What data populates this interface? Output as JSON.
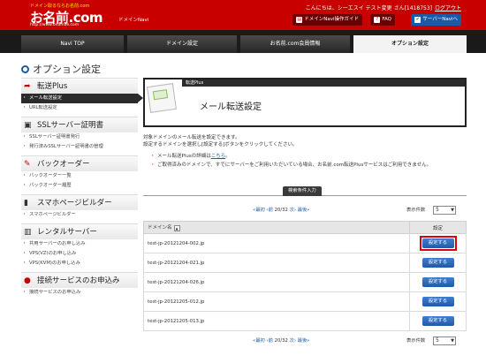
{
  "header": {
    "logo_tagline": "ドメイン取るならお名前.com",
    "logo_main": "お名前.com",
    "logo_url": "http://www.onamae.com",
    "logo_sub": "ドメインNavi",
    "greeting": "こんにちは、シーエスイ テスト変更 さん[1418753]",
    "logout": "ログアウト",
    "buttons": {
      "navi_guide": "ドメインNavi操作ガイド",
      "faq": "FAQ",
      "support": "サーバーNaviへ"
    }
  },
  "nav": {
    "tabs": [
      "Navi TOP",
      "ドメイン設定",
      "お名前.com会員情報",
      "オプション設定"
    ],
    "active_index": 3
  },
  "page_title": "オプション設定",
  "sidebar": {
    "sections": [
      {
        "title": "転送Plus",
        "icon": "arrow-icon",
        "items": [
          "メール転送設定",
          "URL転送設定"
        ]
      },
      {
        "title": "SSLサーバー証明書",
        "icon": "ssl-icon",
        "items": [
          "SSLサーバー証明書発行",
          "発行済みSSLサーバー証明書の管理"
        ]
      },
      {
        "title": "バックオーダー",
        "icon": "backorder-icon",
        "items": [
          "バックオーダー一覧",
          "バックオーダー履歴"
        ]
      },
      {
        "title": "スマホページビルダー",
        "icon": "smartphone-icon",
        "items": [
          "スマホページビルダー"
        ]
      },
      {
        "title": "レンタルサーバー",
        "icon": "server-icon",
        "items": [
          "共用サーバーのお申し込み",
          "VPS(VZ)のお申し込み",
          "VPS(KVM)のお申し込み"
        ]
      },
      {
        "title": "接続サービスのお申込み",
        "icon": "connect-icon",
        "items": [
          "接続サービスのお申込み"
        ]
      }
    ],
    "active_item": "メール転送設定"
  },
  "banner": {
    "strip": "転送Plus",
    "title": "メール転送設定"
  },
  "description": {
    "line1": "対象ドメインのメール転送を設定できます。",
    "line2": "設定するドメインを選択し[設定する]ボタンをクリックしてください。"
  },
  "notes": {
    "note1_prefix": "メール転送Plusの詳細は",
    "note1_link": "こちら",
    "note1_suffix": "。",
    "note2": "ご取得済みのドメインで、すでにサーバーをご利用いただいている場合、お名前.com転送Plusサービスはご利用できません。"
  },
  "search_tab": "検索条件入力",
  "pager": {
    "first": "«最初",
    "prev": "‹前",
    "current": "20/32",
    "next": "次›",
    "last": "最後»",
    "per_page_label": "表示件数",
    "per_page_value": "5"
  },
  "table": {
    "headers": {
      "domain": "ドメイン名",
      "setting": "設定"
    },
    "button_label": "設定する",
    "rows": [
      {
        "domain": "test-jp-20121204-002.jp",
        "highlight": true
      },
      {
        "domain": "test-jp-20121204-021.jp",
        "highlight": false
      },
      {
        "domain": "test-jp-20121204-026.jp",
        "highlight": false
      },
      {
        "domain": "test-jp-20121205-012.jp",
        "highlight": false
      },
      {
        "domain": "test-jp-20121205-013.jp",
        "highlight": false
      }
    ]
  },
  "colors": {
    "brand_red": "#c90000",
    "nav_dark": "#1a1a1a",
    "button_blue": "#1f5aa8",
    "highlight_red": "#e00000"
  }
}
